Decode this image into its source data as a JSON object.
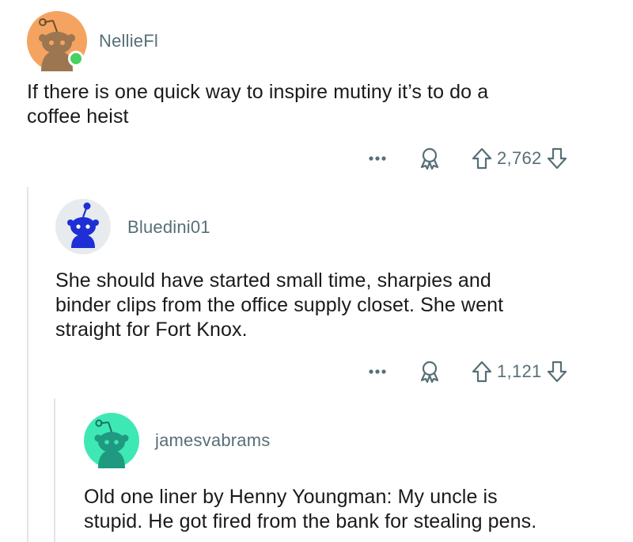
{
  "comments": [
    {
      "username": "NellieFl",
      "avatar_color": "#f4a460",
      "avatar_icon": "snoo-avatar-icon",
      "online": true,
      "body_lines": [
        "If there is one quick way to inspire mutiny it’s to do a",
        "coffee heist"
      ],
      "score": "2,762"
    },
    {
      "username": "Bluedini01",
      "avatar_color": "#e8ebed",
      "avatar_icon": "snoo-avatar-icon",
      "online": false,
      "body_lines": [
        "She should have started small time, sharpies and",
        "binder clips from the office supply closet. She went",
        "straight for Fort Knox."
      ],
      "score": "1,121"
    },
    {
      "username": "jamesvabrams",
      "avatar_color": "#3ee8b5",
      "avatar_icon": "snoo-avatar-icon",
      "online": false,
      "body_lines": [
        "Old one liner by Henny Youngman: My uncle is",
        "stupid. He got fired from the bank for stealing pens."
      ]
    }
  ],
  "colors": {
    "meta_text": "#576f76",
    "body_text": "#1a1a1b",
    "thread_line": "#e2e4e6",
    "online": "#46d160"
  },
  "icons": {
    "more": "more-options-icon",
    "award": "award-icon",
    "upvote": "upvote-arrow-icon",
    "downvote": "downvote-arrow-icon"
  }
}
